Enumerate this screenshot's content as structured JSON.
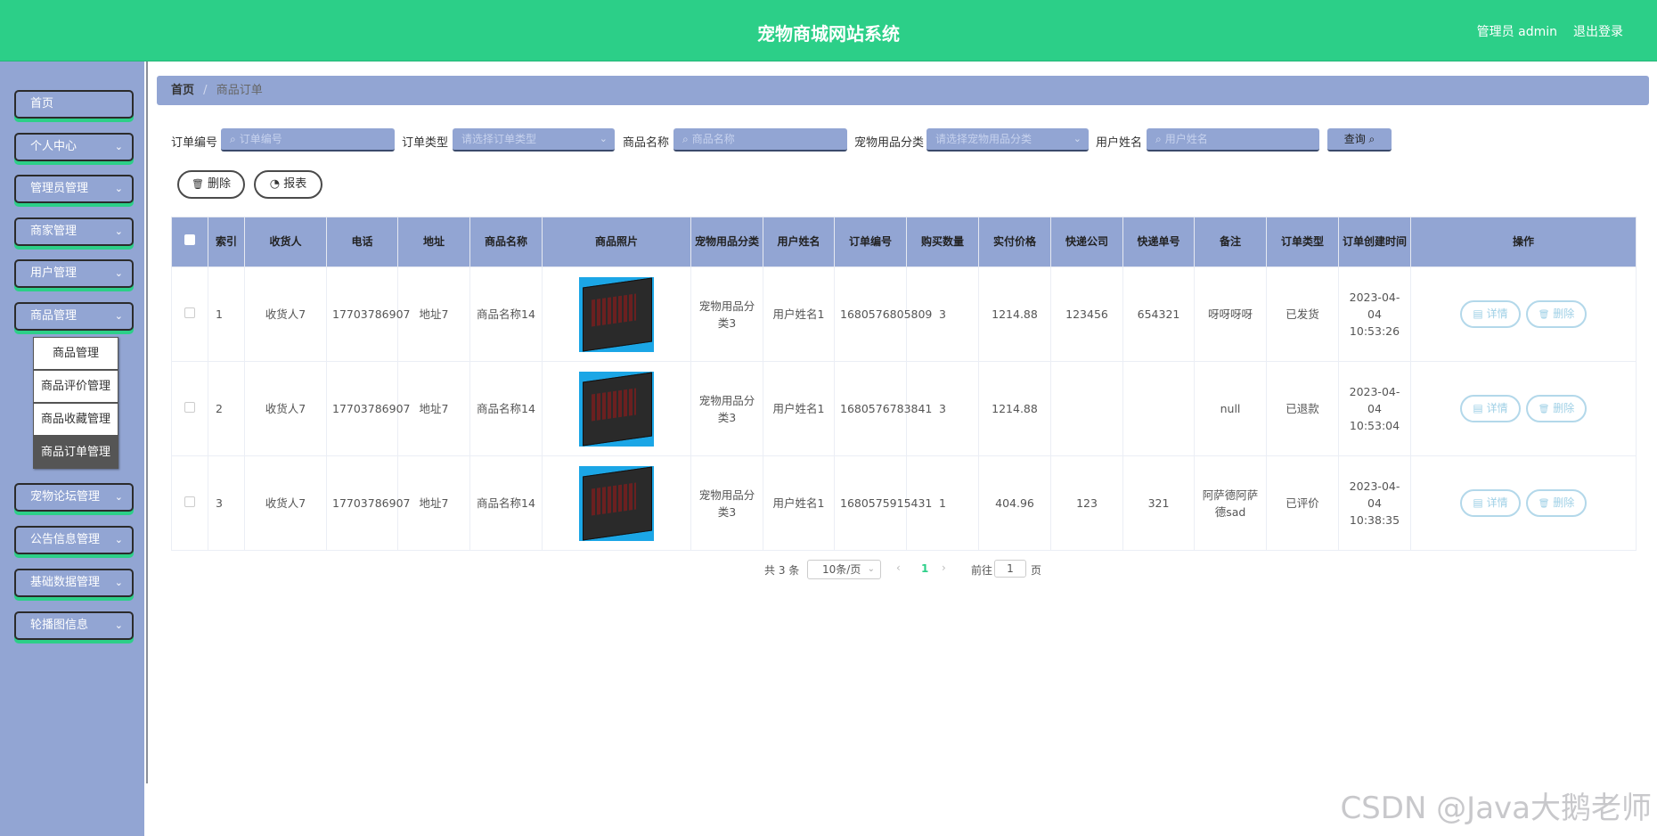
{
  "header": {
    "title": "宠物商城网站系统",
    "user": "管理员 admin",
    "logout": "退出登录"
  },
  "sidebar": {
    "items": [
      {
        "label": "首页",
        "chevron": ""
      },
      {
        "label": "个人中心",
        "chevron": "⌄"
      },
      {
        "label": "管理员管理",
        "chevron": "⌄"
      },
      {
        "label": "商家管理",
        "chevron": "⌄"
      },
      {
        "label": "用户管理",
        "chevron": "⌄"
      },
      {
        "label": "商品管理",
        "chevron": "⌄"
      },
      {
        "label": "宠物论坛管理",
        "chevron": "⌄"
      },
      {
        "label": "公告信息管理",
        "chevron": "⌄"
      },
      {
        "label": "基础数据管理",
        "chevron": "⌄"
      },
      {
        "label": "轮播图信息",
        "chevron": "⌄"
      }
    ],
    "submenu": [
      "商品管理",
      "商品评价管理",
      "商品收藏管理",
      "商品订单管理"
    ]
  },
  "breadcrumb": {
    "home": "首页",
    "sep": "/",
    "current": "商品订单"
  },
  "search": {
    "order_no_label": "订单编号",
    "order_no_placeholder": "订单编号",
    "order_type_label": "订单类型",
    "order_type_placeholder": "请选择订单类型",
    "product_name_label": "商品名称",
    "product_name_placeholder": "商品名称",
    "category_label": "宠物用品分类",
    "category_placeholder": "请选择宠物用品分类",
    "username_label": "用户姓名",
    "username_placeholder": "用户姓名",
    "query_label": "查询",
    "search_icon": "⌕",
    "dropdown_icon": "⌄"
  },
  "actions": {
    "delete_label": "删除",
    "report_label": "报表",
    "delete_icon": "🗑",
    "report_icon": "◔"
  },
  "table": {
    "headers": [
      "",
      "索引",
      "收货人",
      "电话",
      "地址",
      "商品名称",
      "商品照片",
      "宠物用品分类",
      "用户姓名",
      "订单编号",
      "购买数量",
      "实付价格",
      "快递公司",
      "快递单号",
      "备注",
      "订单类型",
      "订单创建时间",
      "操作"
    ],
    "rows": [
      {
        "index": "1",
        "receiver": "收货人7",
        "phone": "17703786907",
        "address": "地址7",
        "product": "商品名称14",
        "category": "宠物用品分类3",
        "username": "用户姓名1",
        "order_no": "1680576805809",
        "qty": "3",
        "price": "1214.88",
        "courier": "123456",
        "tracking": "654321",
        "remark": "呀呀呀呀",
        "type": "已发货",
        "created": "2023-04-04 10:53:26"
      },
      {
        "index": "2",
        "receiver": "收货人7",
        "phone": "17703786907",
        "address": "地址7",
        "product": "商品名称14",
        "category": "宠物用品分类3",
        "username": "用户姓名1",
        "order_no": "1680576783841",
        "qty": "3",
        "price": "1214.88",
        "courier": "",
        "tracking": "",
        "remark": "null",
        "type": "已退款",
        "created": "2023-04-04 10:53:04"
      },
      {
        "index": "3",
        "receiver": "收货人7",
        "phone": "17703786907",
        "address": "地址7",
        "product": "商品名称14",
        "category": "宠物用品分类3",
        "username": "用户姓名1",
        "order_no": "1680575915431",
        "qty": "1",
        "price": "404.96",
        "courier": "123",
        "tracking": "321",
        "remark": "阿萨德阿萨德sad",
        "type": "已评价",
        "created": "2023-04-04 10:38:35"
      }
    ],
    "op_detail": "详情",
    "op_delete": "删除",
    "detail_icon": "▤",
    "delete_icon": "🗑"
  },
  "pager": {
    "total": "共 3 条",
    "page_size": "10条/页",
    "current_page": "1",
    "goto_label": "前往",
    "goto_value": "1",
    "page_suffix": "页",
    "prev": "‹",
    "next": "›",
    "dropdown_icon": "⌄"
  },
  "watermark": "CSDN @Java大鹅老师",
  "colors": {
    "header": "#2ccf88",
    "sidebar": "#92a5d3",
    "accent": "#2ccf88"
  }
}
